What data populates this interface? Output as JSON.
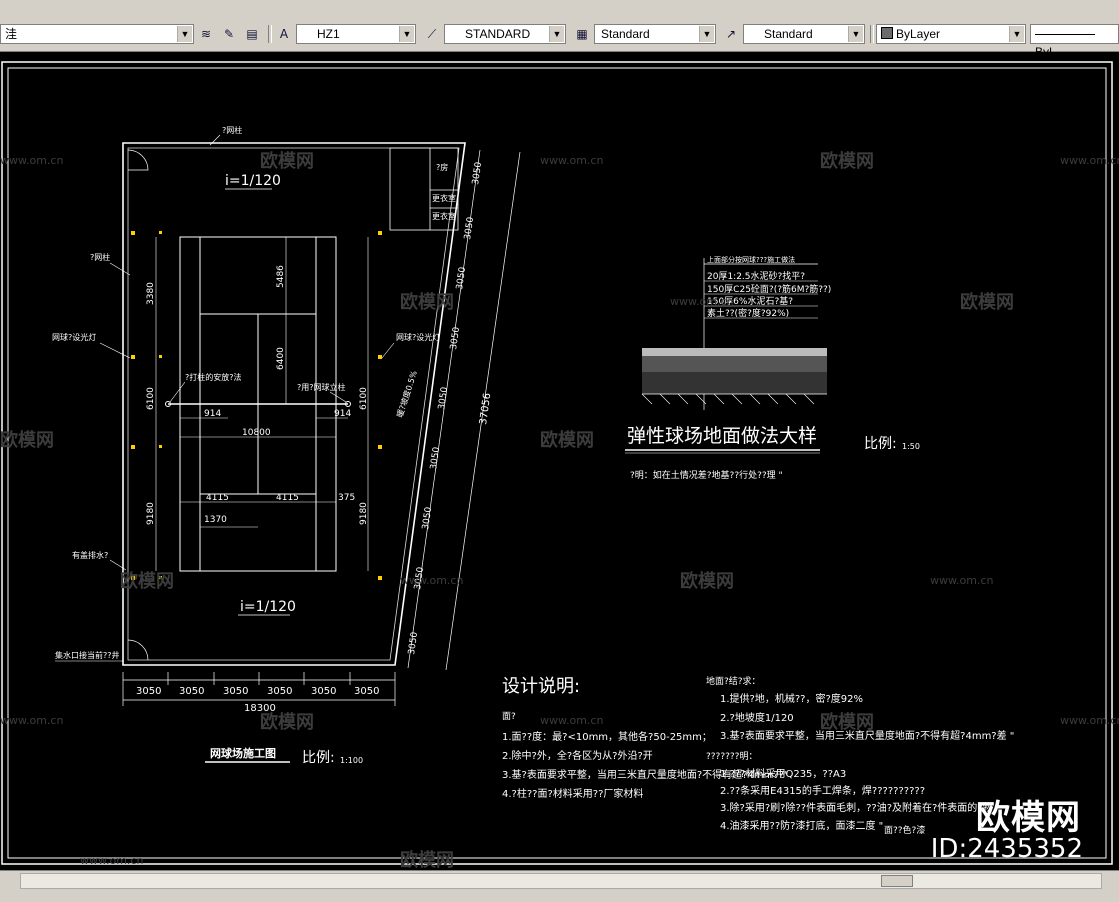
{
  "toolbar": {
    "layer_combo": "洼",
    "text_style": "HZ1",
    "dim_style": "STANDARD",
    "table_style": "Standard",
    "multileader_style": "Standard",
    "color": "ByLayer",
    "linetype": "ByL"
  },
  "drawing": {
    "plan_title": "网球场施工图",
    "plan_scale_label": "比例:",
    "plan_scale": "1:100",
    "slope_top": "i=1/120",
    "slope_bottom": "i=1/120",
    "dim_18300": "18300",
    "dim_3050": "3050",
    "dim_37056": "37056",
    "dim_5486": "5486",
    "dim_6400": "6400",
    "dim_6100": "6100",
    "dim_9180": "9180",
    "dim_3380": "3380",
    "dim_914": "914",
    "dim_10800": "10800",
    "dim_4115": "4115",
    "dim_1370": "1370",
    "dim_375": "375",
    "label_fence_post": "?网柱",
    "label_fence": "?网柱",
    "label_light_left": "网球?设光灯",
    "label_light_right": "网球?设光灯",
    "label_pole": "?打柱的安放?法",
    "label_net": "?用?网球立柱",
    "label_drain": "有盖排水?",
    "label_outlet": "集水口接当前??井",
    "label_slope_right": "暖?坡度0.5%",
    "room_1": "?房",
    "room_2": "更衣室",
    "room_3": "更衣室",
    "detail_title": "弹性球场地面做法大样",
    "detail_scale_label": "比例:",
    "detail_scale": "1:50",
    "detail_layers": [
      "上面部分按网球???施工做法",
      "20厚1:2.5水泥砂?找平?",
      "150厚C25砼面?(?筋6M?筋??)",
      "150厚6%水泥石?基?",
      "素土??(密?度?92%)"
    ],
    "detail_note": "?明：如在土情况差?地基??行处??理 \"",
    "design_heading": "设计说明:",
    "design_sub": "面?",
    "design_items": [
      "1.面??度：最?<10mm，其他各?50-25mm；",
      "2.除中?外，全?各区为从?外沿?开",
      "3.基?表面要求平整，当用三米直尺量度地面?不得有超?4mm??\"",
      "4.?柱??面?材料采用??厂家材料"
    ],
    "ground_heading": "地面?结?求：",
    "ground_items": [
      "1.提供?地，机械??，密?度92%",
      "2.?地坡度1/120",
      "3.基?表面要求平整，当用三米直尺量度地面?不得有超?4mm?差 \""
    ],
    "steel_heading": "???????明：",
    "steel_items": [
      "1.???材料采用Q235，??A3",
      "2.??条采用E4315的手工焊条，焊??????????",
      "3.除?采用?刷?除??件表面毛刺，??油?及附着在?件表面的?物",
      "4.油漆采用??防?漆打底，面漆二度 \""
    ],
    "tail_note": "面??色?漆"
  },
  "watermark": {
    "site": "www.om.cn",
    "brand": "欧模网",
    "id": "ID:2435352"
  }
}
